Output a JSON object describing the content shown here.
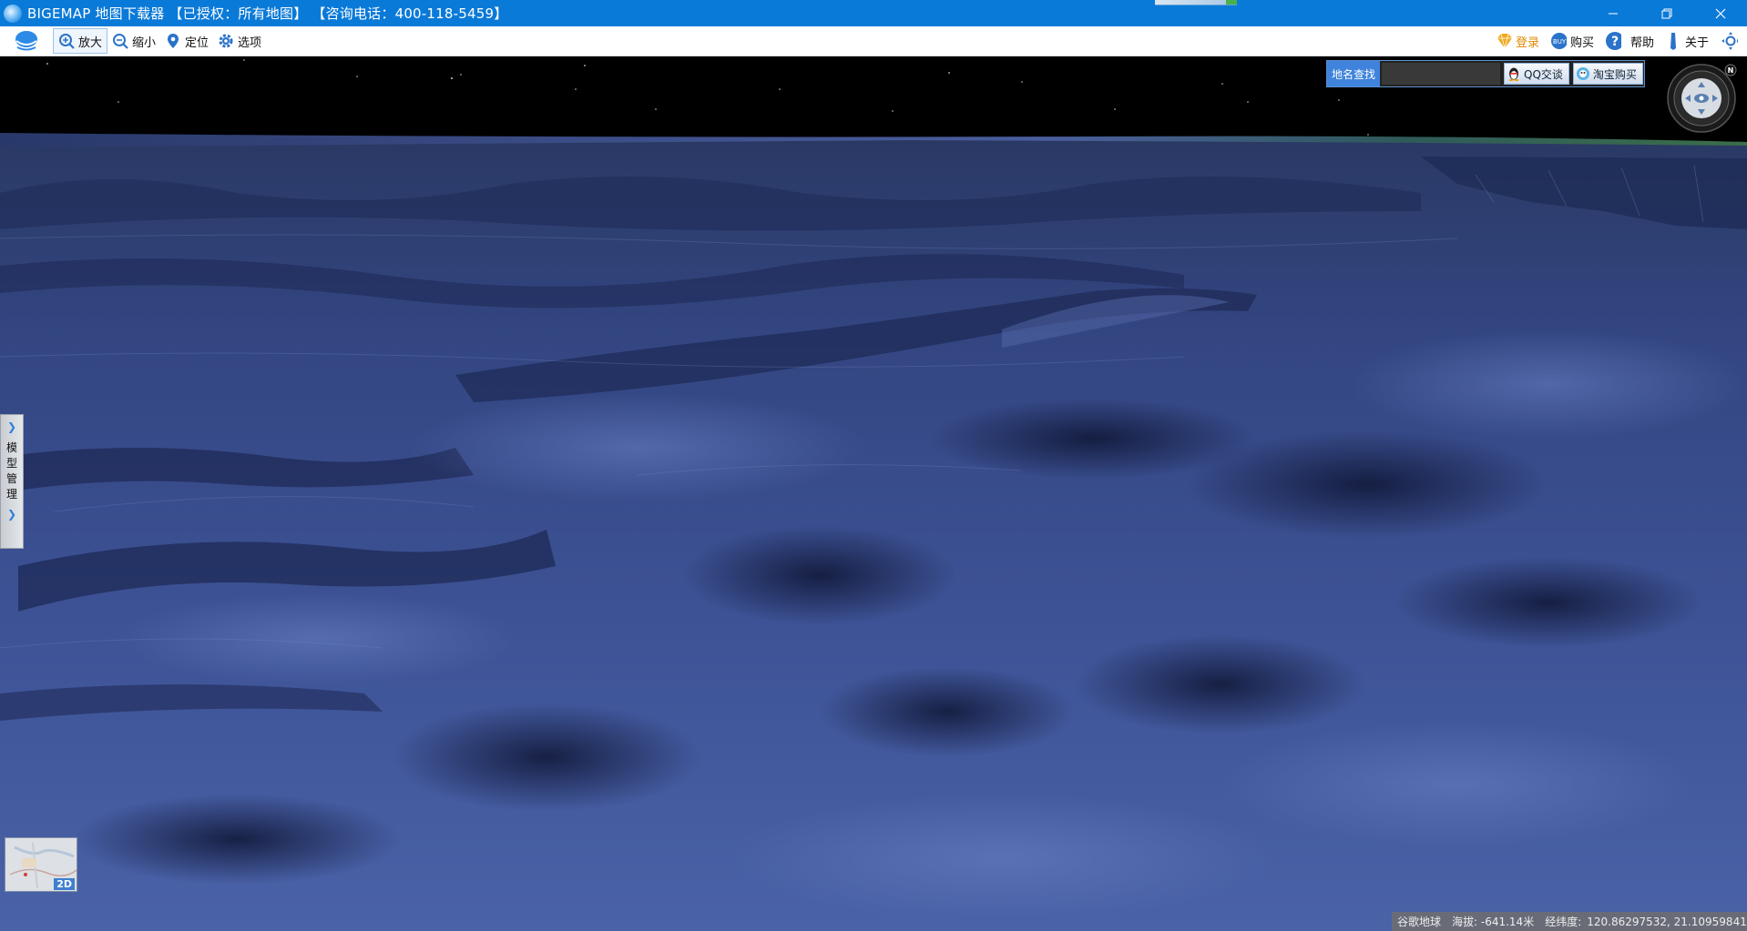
{
  "window": {
    "title": "BIGEMAP 地图下载器 【已授权：所有地图】 【咨询电话：400-118-5459】",
    "controls": {
      "minimize": "—",
      "restore": "❐",
      "close": "✕"
    }
  },
  "toolbar": {
    "zoom_in": "放大",
    "zoom_out": "缩小",
    "locate": "定位",
    "options": "选项",
    "login": "登录",
    "buy": "购买",
    "help": "帮助",
    "about": "关于"
  },
  "search": {
    "label": "地名查找",
    "placeholder": "",
    "qq_button": "QQ交谈",
    "taobao_button": "淘宝购买"
  },
  "side_panel": {
    "label": "模型管理"
  },
  "mini_map": {
    "mode": "2D"
  },
  "status": {
    "source": "谷歌地球",
    "altitude": "海拔: -641.14米",
    "coordinates_label": "经纬度:",
    "coordinates": "120.86297532, 21.10959841"
  },
  "colors": {
    "title_bar": "#0a7ad8",
    "accent": "#3f83dc",
    "terrain": "#2c3d74",
    "sky": "#000000"
  },
  "icons": {
    "zoom_in": "zoom-in-icon",
    "zoom_out": "zoom-out-icon",
    "locate": "map-pin-icon",
    "options": "gear-icon",
    "login": "diamond-icon",
    "buy": "buy-icon",
    "help": "help-icon",
    "about": "about-icon",
    "fullscreen": "fullscreen-icon"
  }
}
